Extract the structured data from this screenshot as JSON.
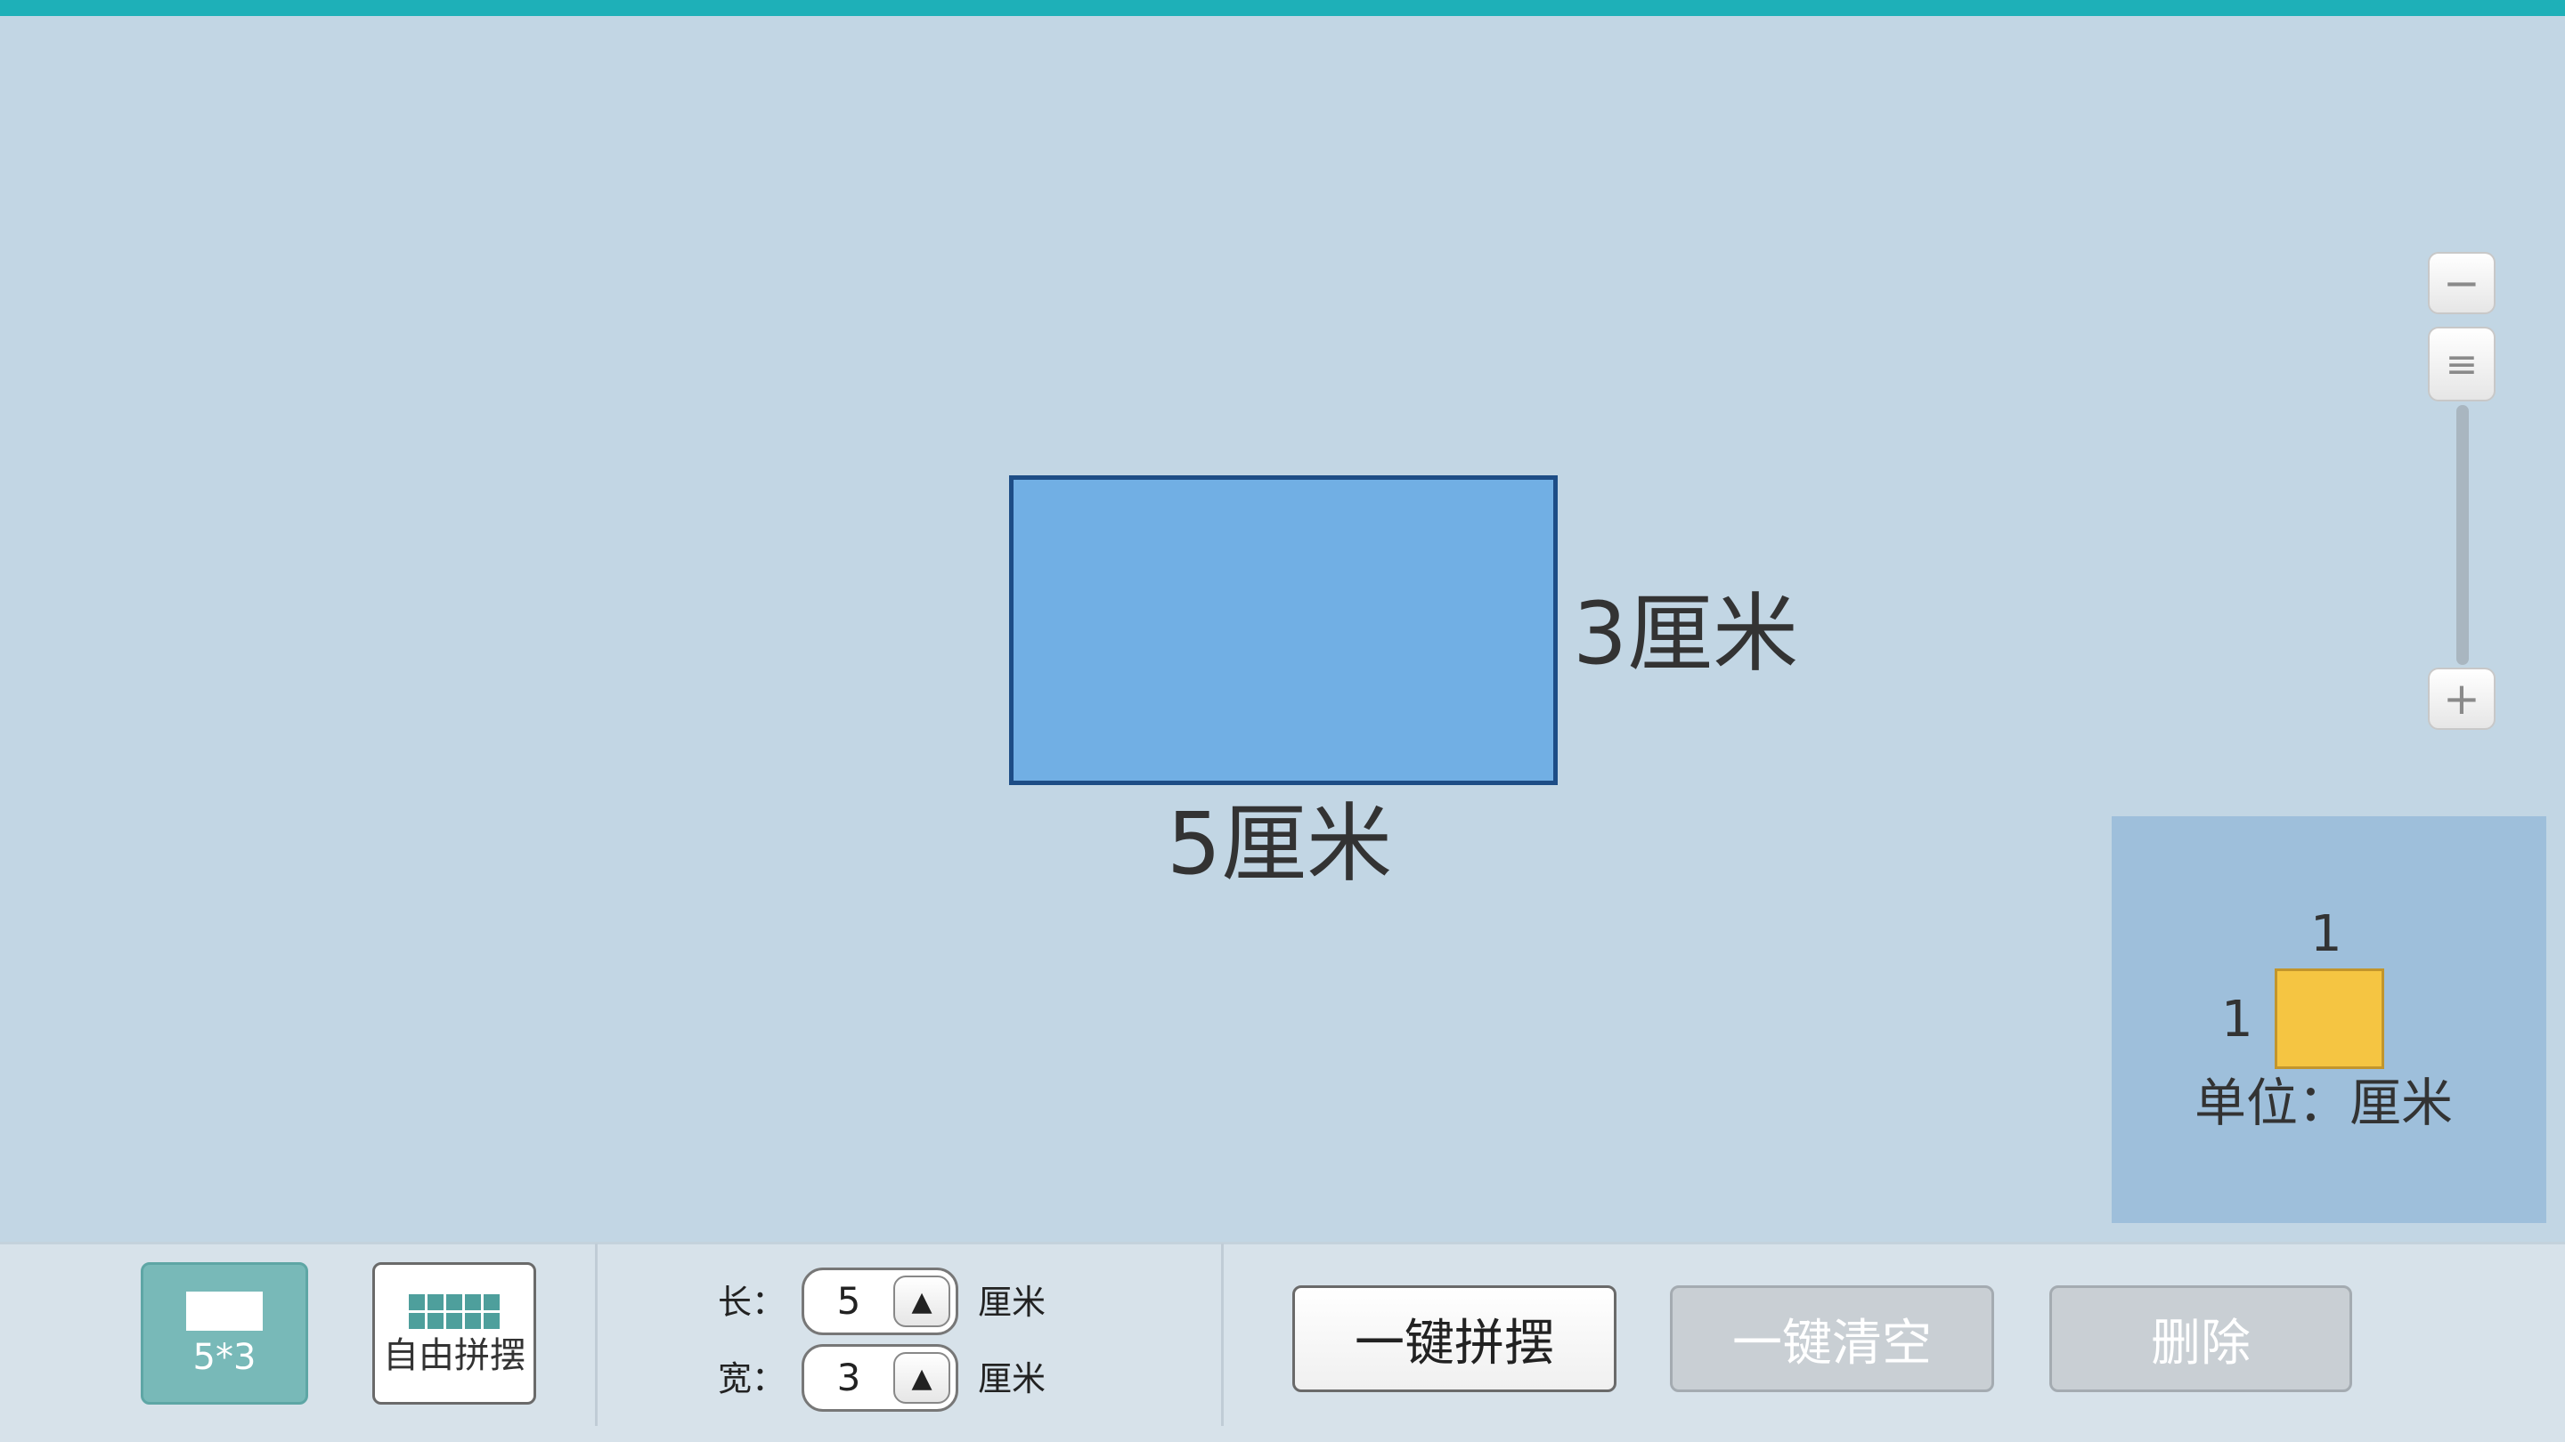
{
  "shape": {
    "width_label": "5厘米",
    "height_label": "3厘米",
    "fill_color": "#71afe4",
    "border_color": "#1d4d86"
  },
  "zoom": {
    "minus_label": "−",
    "handle_label": "≡",
    "plus_label": "+"
  },
  "unit_legend": {
    "top_value": "1",
    "side_value": "1",
    "label": "单位：厘米",
    "square_color": "#f5c542"
  },
  "toolbar": {
    "preset_label": "5*3",
    "free_label": "自由拼摆",
    "length_label": "长：",
    "length_value": "5",
    "width_label": "宽：",
    "width_value": "3",
    "unit": "厘米",
    "spin_up_icon": "▲",
    "arrange_label": "一键拼摆",
    "clear_label": "一键清空",
    "delete_label": "删除",
    "accent_color": "#78b9b8"
  }
}
